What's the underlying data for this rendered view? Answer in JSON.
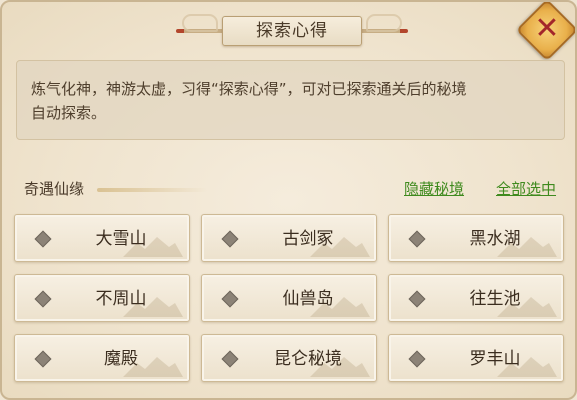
{
  "window": {
    "title": "探索心得"
  },
  "description": {
    "line1": "炼气化神，神游太虚，习得“探索心得”，可对已探索通关后的秘境",
    "line2": "自动探索。"
  },
  "section": {
    "label": "奇遇仙缘",
    "hide_link": "隐藏秘境",
    "select_all_link": "全部选中"
  },
  "realms": [
    {
      "name": "大雪山",
      "selected": false
    },
    {
      "name": "古剑冢",
      "selected": false
    },
    {
      "name": "黑水湖",
      "selected": false
    },
    {
      "name": "不周山",
      "selected": false
    },
    {
      "name": "仙兽岛",
      "selected": false
    },
    {
      "name": "往生池",
      "selected": false
    },
    {
      "name": "魔殿",
      "selected": false
    },
    {
      "name": "昆仑秘境",
      "selected": false
    },
    {
      "name": "罗丰山",
      "selected": false
    }
  ],
  "colors": {
    "link": "#3f8a1e",
    "close_button": "#e9b04b",
    "close_glyph": "#a3262a"
  },
  "icons": {
    "close": "close-icon",
    "checkbox": "diamond-checkbox-icon"
  }
}
